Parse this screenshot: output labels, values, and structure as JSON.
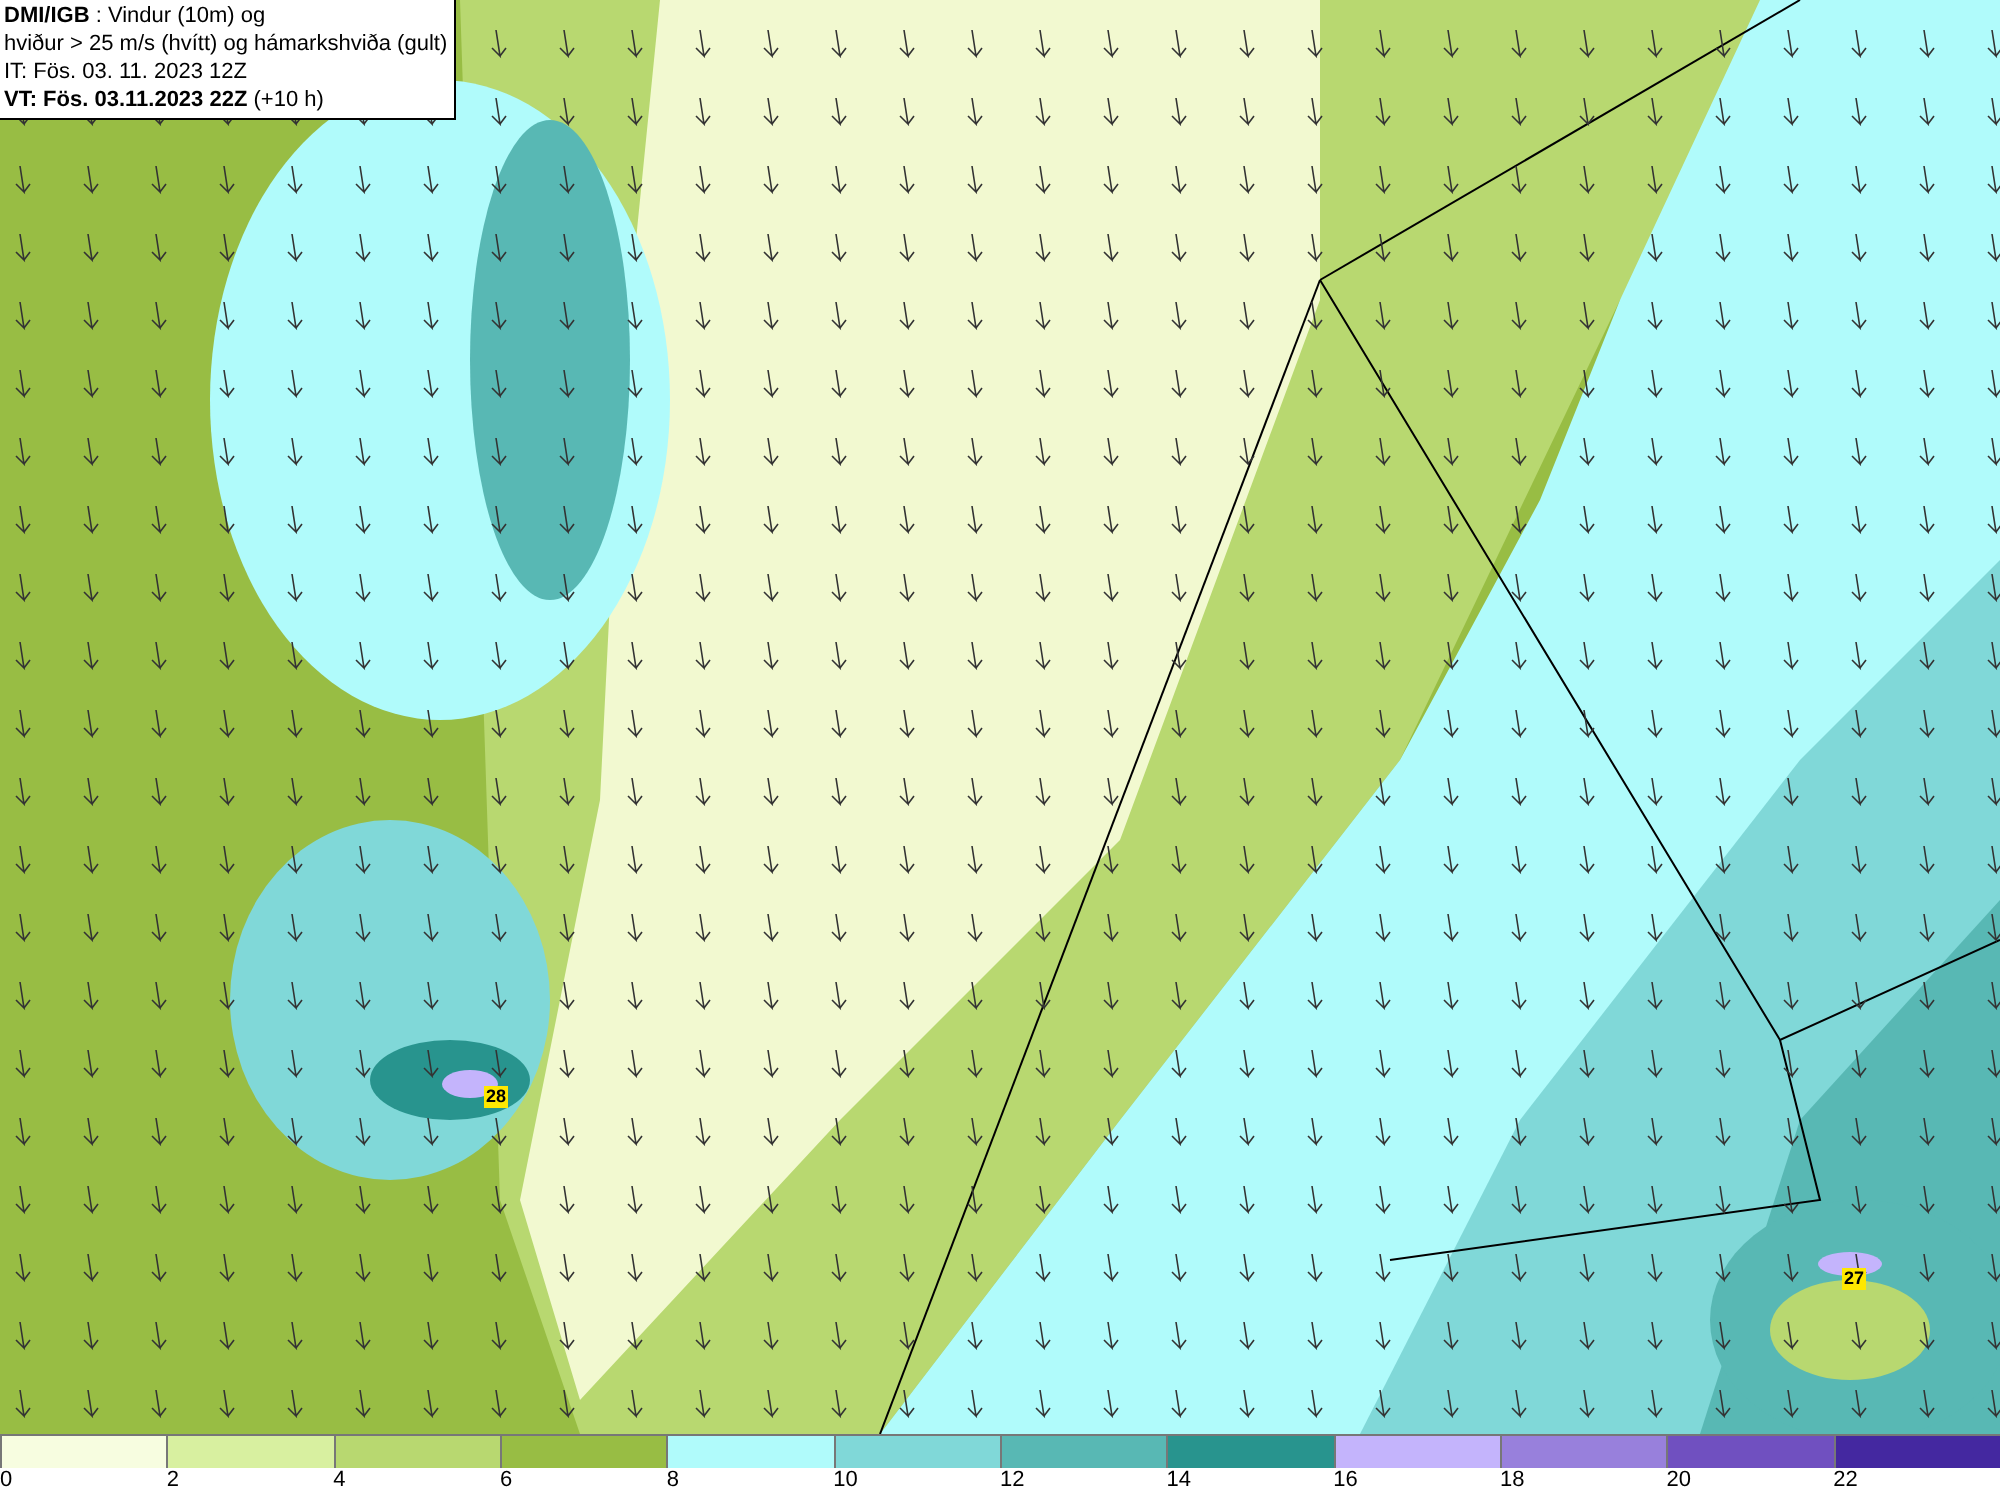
{
  "title_box": {
    "lines": [
      "**DMI/IGB** : Vindur (10m) og",
      "hviður > 25 m/s (hvítt) og hámarkshviða (gult)",
      "IT: Fös. 03. 11. 2023 12Z",
      "**VT: Fös. 03.11.2023 22Z** (+10 h)"
    ]
  },
  "map": {
    "gust_labels": [
      "28",
      "27"
    ]
  },
  "legend": [
    {
      "label": "0",
      "color": "#f7fde0"
    },
    {
      "label": "2",
      "color": "#d8f0a0"
    },
    {
      "label": "4",
      "color": "#b8d870"
    },
    {
      "label": "6",
      "color": "#98bd44"
    },
    {
      "label": "8",
      "color": "#b0fbfb"
    },
    {
      "label": "10",
      "color": "#80d8d8"
    },
    {
      "label": "12",
      "color": "#58b8b4"
    },
    {
      "label": "14",
      "color": "#28948e"
    },
    {
      "label": "16",
      "color": "#c4b4fc"
    },
    {
      "label": "18",
      "color": "#9880dc"
    },
    {
      "label": "20",
      "color": "#7050c0"
    },
    {
      "label": "22",
      "color": "#4428a0"
    }
  ]
}
